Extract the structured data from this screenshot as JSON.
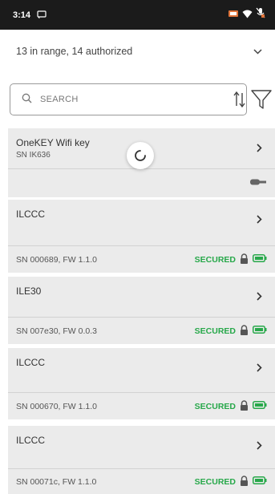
{
  "statusbar": {
    "time": "3:14"
  },
  "range": {
    "summary": "13 in range, 14 authorized"
  },
  "search": {
    "placeholder": "SEARCH"
  },
  "devices": [
    {
      "name": "OneKEY Wifi key",
      "serial": "SN IK636",
      "details": "",
      "status": ""
    },
    {
      "name": "ILCCC",
      "serial": "",
      "details": "SN 000689, FW 1.1.0",
      "status": "SECURED"
    },
    {
      "name": "ILE30",
      "serial": "",
      "details": "SN 007e30, FW 0.0.3",
      "status": "SECURED"
    },
    {
      "name": "ILCCC",
      "serial": "",
      "details": "SN 000670, FW 1.1.0",
      "status": "SECURED"
    },
    {
      "name": "ILCCC",
      "serial": "",
      "details": "SN 00071c, FW 1.1.0",
      "status": "SECURED"
    }
  ],
  "colors": {
    "accent_green": "#27a84a",
    "card_bg": "#ebebeb",
    "statusbar_bg": "#1b1b1b"
  },
  "icons": {
    "search": "search-icon",
    "sort": "sort-icon",
    "filter": "filter-icon",
    "chevron_right": "chevron-right-icon",
    "lock": "lock-icon",
    "battery": "battery-icon",
    "key": "key-icon",
    "loader": "loading-spinner-icon"
  }
}
